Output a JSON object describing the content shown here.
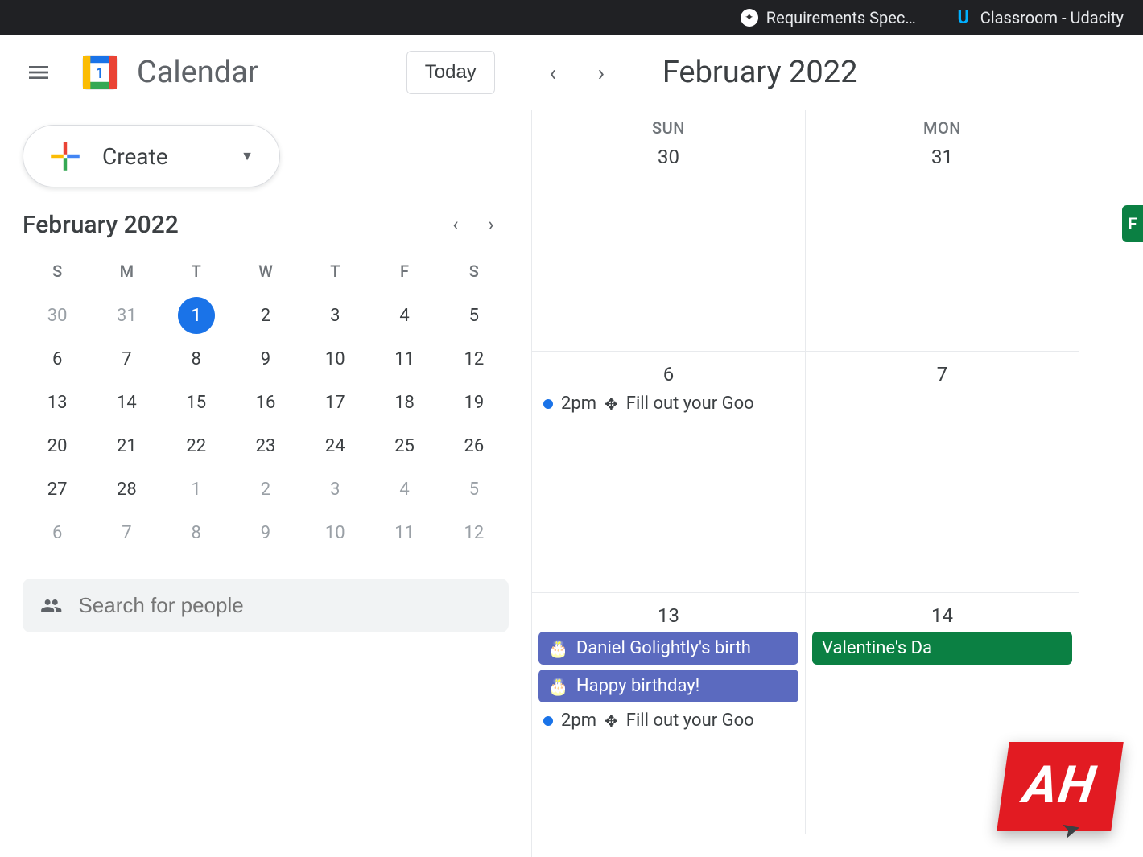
{
  "browser": {
    "tabs": [
      {
        "label": "Requirements Spec…"
      },
      {
        "label": "Classroom - Udacity"
      }
    ]
  },
  "header": {
    "app_title": "Calendar",
    "today_label": "Today",
    "date_title": "February 2022"
  },
  "create": {
    "label": "Create"
  },
  "mini_cal": {
    "title": "February 2022",
    "dow": [
      "S",
      "M",
      "T",
      "W",
      "T",
      "F",
      "S"
    ],
    "rows": [
      [
        {
          "n": "30",
          "muted": true
        },
        {
          "n": "31",
          "muted": true
        },
        {
          "n": "1",
          "today": true
        },
        {
          "n": "2"
        },
        {
          "n": "3"
        },
        {
          "n": "4"
        },
        {
          "n": "5"
        }
      ],
      [
        {
          "n": "6"
        },
        {
          "n": "7"
        },
        {
          "n": "8"
        },
        {
          "n": "9"
        },
        {
          "n": "10"
        },
        {
          "n": "11"
        },
        {
          "n": "12"
        }
      ],
      [
        {
          "n": "13"
        },
        {
          "n": "14"
        },
        {
          "n": "15"
        },
        {
          "n": "16"
        },
        {
          "n": "17"
        },
        {
          "n": "18"
        },
        {
          "n": "19"
        }
      ],
      [
        {
          "n": "20"
        },
        {
          "n": "21"
        },
        {
          "n": "22"
        },
        {
          "n": "23"
        },
        {
          "n": "24"
        },
        {
          "n": "25"
        },
        {
          "n": "26"
        }
      ],
      [
        {
          "n": "27"
        },
        {
          "n": "28"
        },
        {
          "n": "1",
          "muted": true
        },
        {
          "n": "2",
          "muted": true
        },
        {
          "n": "3",
          "muted": true
        },
        {
          "n": "4",
          "muted": true
        },
        {
          "n": "5",
          "muted": true
        }
      ],
      [
        {
          "n": "6",
          "muted": true
        },
        {
          "n": "7",
          "muted": true
        },
        {
          "n": "8",
          "muted": true
        },
        {
          "n": "9",
          "muted": true
        },
        {
          "n": "10",
          "muted": true
        },
        {
          "n": "11",
          "muted": true
        },
        {
          "n": "12",
          "muted": true
        }
      ]
    ]
  },
  "search": {
    "placeholder": "Search for people"
  },
  "grid": {
    "columns": [
      {
        "dow": "SUN",
        "days": [
          {
            "num": "30",
            "events": []
          },
          {
            "num": "6",
            "events": [
              {
                "type": "dot",
                "time": "2pm",
                "title": "Fill out your Goo"
              }
            ]
          },
          {
            "num": "13",
            "events": [
              {
                "type": "chip",
                "color": "blue",
                "icon": "cake",
                "title": "Daniel Golightly's birth"
              },
              {
                "type": "chip",
                "color": "blue",
                "icon": "cake",
                "title": "Happy birthday!"
              },
              {
                "type": "dot",
                "time": "2pm",
                "title": "Fill out your Goo"
              }
            ]
          }
        ]
      },
      {
        "dow": "MON",
        "days": [
          {
            "num": "31",
            "events": []
          },
          {
            "num": "7",
            "events": []
          },
          {
            "num": "14",
            "events": [
              {
                "type": "chip",
                "color": "green",
                "title": "Valentine's Da"
              }
            ]
          }
        ]
      }
    ],
    "green_slice_label": "F"
  },
  "badge": {
    "text": "AH"
  }
}
